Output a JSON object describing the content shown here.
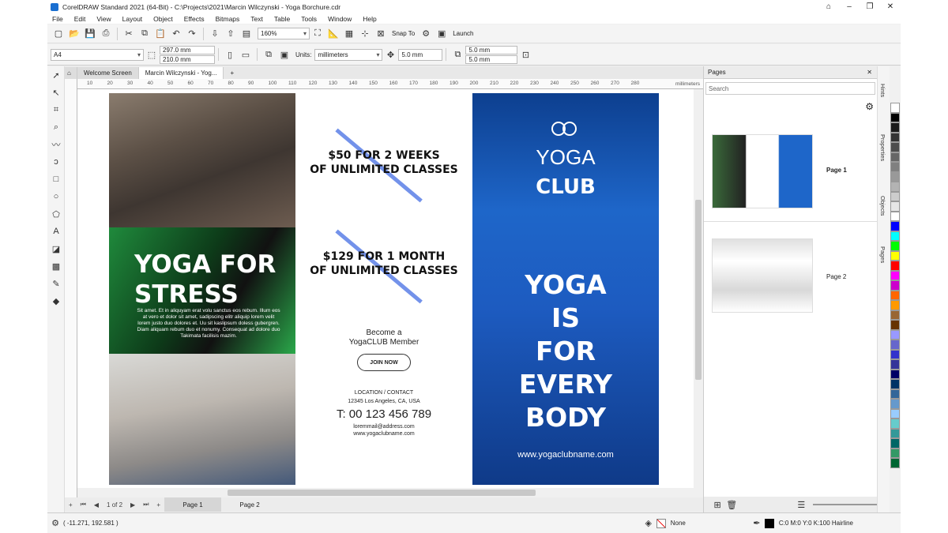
{
  "window": {
    "title": "CorelDRAW Standard 2021 (64-Bit) - C:\\Projects\\2021\\Marcin Wilczynski - Yoga Borchure.cdr"
  },
  "menu": [
    "File",
    "Edit",
    "View",
    "Layout",
    "Object",
    "Effects",
    "Bitmaps",
    "Text",
    "Table",
    "Tools",
    "Window",
    "Help"
  ],
  "toolbar": {
    "zoom": "160%",
    "snap_to": "Snap To",
    "launch": "Launch"
  },
  "propbar": {
    "paper": "A4",
    "width": "297.0 mm",
    "height": "210.0 mm",
    "units_label": "Units:",
    "units": "millimeters",
    "nudge": "5.0 mm",
    "dup_x": "5.0 mm",
    "dup_y": "5.0 mm"
  },
  "tabs": {
    "welcome": "Welcome Screen",
    "doc": "Marcin Wilczynski - Yog..."
  },
  "ruler": {
    "unit": "millimeters",
    "ticks": [
      "10",
      "20",
      "30",
      "40",
      "50",
      "60",
      "70",
      "80",
      "90",
      "100",
      "110",
      "120",
      "130",
      "140",
      "150",
      "160",
      "170",
      "180",
      "190",
      "200",
      "210",
      "220",
      "230",
      "240",
      "250",
      "260",
      "270",
      "280"
    ]
  },
  "brochure": {
    "panel1": {
      "heading1": "YOGA FOR",
      "heading2": "STRESS",
      "lorem": "Sit amet. Et in aliquyam erat volu sanctus eos rebum. Illum eos at vero et dolor sit amet, sadipscing elitr aliquip lorem velit lorem justo duo dolores et. Uu sit kaslipsum doless gubergren. Diam aliquam rebum duo et nonumy. Consequat ad dolore duo Takimata facilisis mazim."
    },
    "panel2": {
      "offer1a": "$50 FOR 2 WEEKS",
      "offer1b": "OF UNLIMITED CLASSES",
      "offer2a": "$129 FOR 1 MONTH",
      "offer2b": "OF UNLIMITED CLASSES",
      "member1": "Become a",
      "member2": "YogaCLUB Member",
      "join": "JOIN NOW",
      "loc_title": "LOCATION / CONTACT",
      "address": "12345 Los Angeles, CA, USA",
      "phone": "T: 00 123 456 789",
      "email": "loremmail@address.com",
      "web": "www.yogaclubname.com"
    },
    "panel3": {
      "yoga": "YOGA",
      "club": "CLUB",
      "line1": "YOGA",
      "line2": "IS",
      "line3": "FOR",
      "line4": "EVERY",
      "line5": "BODY",
      "url": "www.yogaclubname.com"
    }
  },
  "pagebar": {
    "position": "1 of 2",
    "page1": "Page 1",
    "page2": "Page 2"
  },
  "status": {
    "coords": "( -11.271, 192.581 )",
    "fill": "None",
    "outline": "C:0 M:0 Y:0 K:100  Hairline"
  },
  "pages_panel": {
    "title": "Pages",
    "search": "Search",
    "page1": "Page 1",
    "page2": "Page 2"
  },
  "side_tabs": [
    "Hints",
    "Properties",
    "Objects",
    "Pages"
  ],
  "palette": [
    "#ffffff",
    "#000000",
    "#1a1a1a",
    "#333333",
    "#4d4d4d",
    "#666666",
    "#808080",
    "#999999",
    "#b3b3b3",
    "#cccccc",
    "#e6e6e6",
    "#ffffff",
    "#0000ff",
    "#00ffff",
    "#00ff00",
    "#ffff00",
    "#ff0000",
    "#ff00ff",
    "#cc00cc",
    "#ff6600",
    "#ff9900",
    "#996633",
    "#663300",
    "#9999ff",
    "#6666cc",
    "#3333cc",
    "#333399",
    "#000066",
    "#003366",
    "#336699",
    "#6699cc",
    "#99ccff",
    "#66cccc",
    "#339999",
    "#006666",
    "#339966",
    "#006633"
  ]
}
